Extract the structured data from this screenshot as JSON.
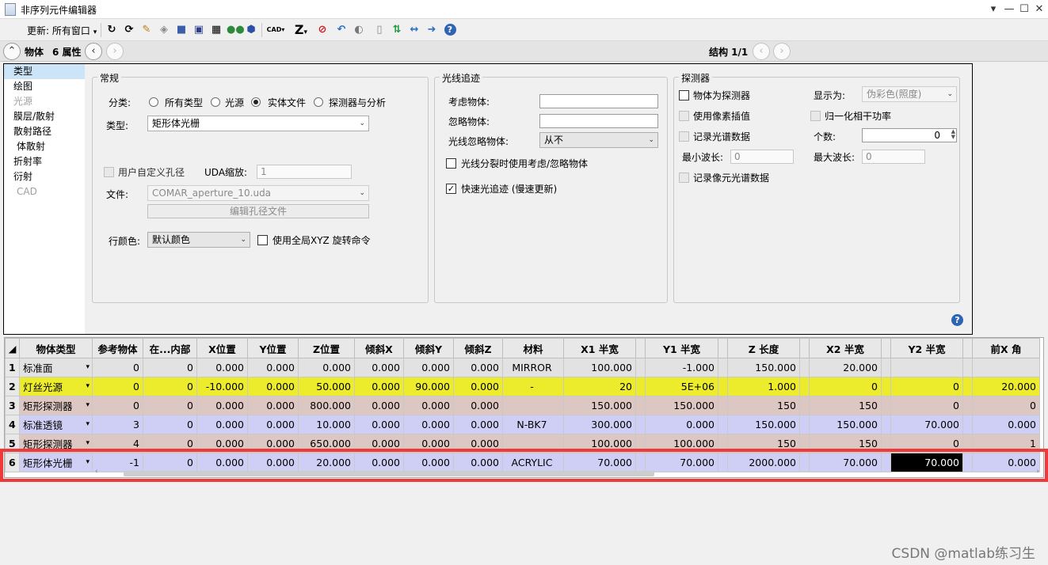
{
  "window": {
    "title": "非序列元件编辑器",
    "controls": [
      "▾",
      "—",
      "☐",
      "✕"
    ]
  },
  "toolbar": {
    "update_label": "更新:",
    "update_value": "所有窗口",
    "icons": [
      "refresh-icon",
      "refresh-all-icon",
      "ray-trace-icon",
      "layout-icon",
      "shaded-model-icon",
      "solid-model-icon",
      "grid-icon",
      "detector-icon",
      "object-icon",
      "cad-icon",
      "z-icon",
      "stop-icon",
      "undo-icon",
      "toggle-icon",
      "page-icon",
      "swap-icon",
      "arrows-icon",
      "arrow-right-icon",
      "help-icon"
    ],
    "cad_label": "CAD",
    "z_label": "Z"
  },
  "nav": {
    "object_label": "物体",
    "props_label": "6 属性",
    "config_label": "结构 1/1"
  },
  "categories": [
    {
      "label": "类型",
      "selected": true,
      "disabled": false
    },
    {
      "label": "绘图",
      "selected": false,
      "disabled": false
    },
    {
      "label": "光源",
      "selected": false,
      "disabled": true
    },
    {
      "label": "膜层/散射",
      "selected": false,
      "disabled": false
    },
    {
      "label": "散射路径",
      "selected": false,
      "disabled": false
    },
    {
      "label": "体散射",
      "selected": false,
      "disabled": false
    },
    {
      "label": "折射率",
      "selected": false,
      "disabled": false
    },
    {
      "label": "衍射",
      "selected": false,
      "disabled": false
    },
    {
      "label": "CAD",
      "selected": false,
      "disabled": true
    }
  ],
  "general": {
    "title": "常规",
    "class_label": "分类:",
    "radios": [
      "所有类型",
      "光源",
      "实体文件",
      "探测器与分析"
    ],
    "type_label": "类型:",
    "type_value": "矩形体光栅",
    "uda_check_label": "用户自定义孔径",
    "uda_scale_label": "UDA缩放:",
    "uda_scale_value": "1",
    "file_label": "文件:",
    "file_value": "COMAR_aperture_10.uda",
    "edit_btn": "编辑孔径文件",
    "row_color_label": "行颜色:",
    "row_color_value": "默认颜色",
    "global_xyz_label": "使用全局XYZ 旋转命令"
  },
  "raytrace": {
    "title": "光线追迹",
    "consider_label": "考虑物体:",
    "ignore_label": "忽略物体:",
    "ray_ignore_label": "光线忽略物体:",
    "ray_ignore_value": "从不",
    "split_label": "光线分裂时使用考虑/忽略物体",
    "fast_label": "快速光追迹 (慢速更新)"
  },
  "detector": {
    "title": "探测器",
    "is_detector_label": "物体为探测器",
    "show_as_label": "显示为:",
    "show_as_value": "伪彩色(照度)",
    "pixel_interp_label": "使用像素插值",
    "normalize_label": "归一化相干功率",
    "record_spectrum_label": "记录光谱数据",
    "count_label": "个数:",
    "count_value": "0",
    "min_wave_label": "最小波长:",
    "min_wave_value": "0",
    "max_wave_label": "最大波长:",
    "max_wave_value": "0",
    "record_pixel_label": "记录像元光谱数据"
  },
  "table": {
    "headers": [
      "物体类型",
      "参考物体",
      "在...内部",
      "X位置",
      "Y位置",
      "Z位置",
      "倾斜X",
      "倾斜Y",
      "倾斜Z",
      "材料",
      "X1 半宽",
      "",
      "Y1 半宽",
      "",
      "Z 长度",
      "",
      "X2 半宽",
      "",
      "Y2 半宽",
      "",
      "前X 角"
    ],
    "rows": [
      {
        "n": "1",
        "cells": [
          "标准面",
          "0",
          "0",
          "0.000",
          "0.000",
          "0.000",
          "0.000",
          "0.000",
          "0.000",
          "MIRROR",
          "100.000",
          "",
          "-1.000",
          "",
          "150.000",
          "",
          "20.000",
          "",
          "",
          "",
          ""
        ]
      },
      {
        "n": "2",
        "cells": [
          "灯丝光源",
          "0",
          "0",
          "-10.000",
          "0.000",
          "50.000",
          "0.000",
          "90.000",
          "0.000",
          "-",
          "20",
          "",
          "5E+06",
          "",
          "1.000",
          "",
          "0",
          "",
          "0",
          "",
          "20.000"
        ]
      },
      {
        "n": "3",
        "cells": [
          "矩形探测器",
          "0",
          "0",
          "0.000",
          "0.000",
          "800.000",
          "0.000",
          "0.000",
          "0.000",
          "",
          "150.000",
          "",
          "150.000",
          "",
          "150",
          "",
          "150",
          "",
          "0",
          "",
          "0"
        ]
      },
      {
        "n": "4",
        "cells": [
          "标准透镜",
          "3",
          "0",
          "0.000",
          "0.000",
          "10.000",
          "0.000",
          "0.000",
          "0.000",
          "N-BK7",
          "300.000",
          "",
          "0.000",
          "",
          "150.000",
          "",
          "150.000",
          "",
          "70.000",
          "",
          "0.000"
        ]
      },
      {
        "n": "5",
        "cells": [
          "矩形探测器",
          "4",
          "0",
          "0.000",
          "0.000",
          "650.000",
          "0.000",
          "0.000",
          "0.000",
          "",
          "100.000",
          "",
          "100.000",
          "",
          "150",
          "",
          "150",
          "",
          "0",
          "",
          "1"
        ]
      },
      {
        "n": "6",
        "cells": [
          "矩形体光栅",
          "-1",
          "0",
          "0.000",
          "0.000",
          "20.000",
          "0.000",
          "0.000",
          "0.000",
          "ACRYLIC",
          "70.000",
          "",
          "70.000",
          "",
          "2000.000",
          "",
          "70.000",
          "",
          "70.000",
          "",
          "0.000"
        ]
      }
    ],
    "active_row": 5,
    "active_col": 18
  },
  "watermark": "CSDN @matlab练习生",
  "colors": {
    "row_gray": "#e2e2e2",
    "row_yellow": "#ecec2c",
    "row_rose": "#ddc7c2",
    "row_lavender": "#cfcff5",
    "highlight": "#ee3a3a"
  }
}
